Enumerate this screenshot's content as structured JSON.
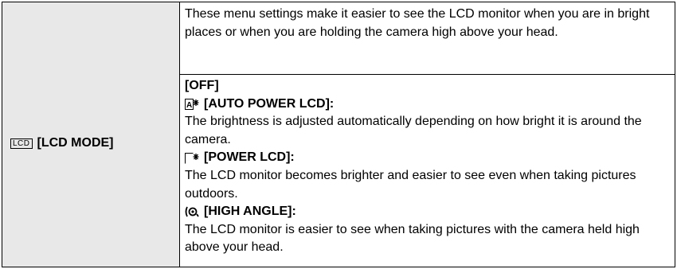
{
  "setting": {
    "icon": "lcd-icon",
    "icon_text": "LCD",
    "label": "[LCD MODE]"
  },
  "description": "These menu settings make it easier to see the LCD monitor when you are in bright places or when you are holding the camera high above your head.",
  "options": [
    {
      "heading": "[OFF]",
      "icon": null,
      "text": null
    },
    {
      "heading": "[AUTO POWER LCD]:",
      "icon": "auto-power-lcd-icon",
      "text": "The brightness is adjusted automatically depending on how bright it is around the camera."
    },
    {
      "heading": "[POWER LCD]:",
      "icon": "power-lcd-icon",
      "text": "The LCD monitor becomes brighter and easier to see even when taking pictures outdoors."
    },
    {
      "heading": "[HIGH ANGLE]:",
      "icon": "high-angle-icon",
      "text": "The LCD monitor is easier to see when taking pictures with the camera held high above your head."
    }
  ]
}
